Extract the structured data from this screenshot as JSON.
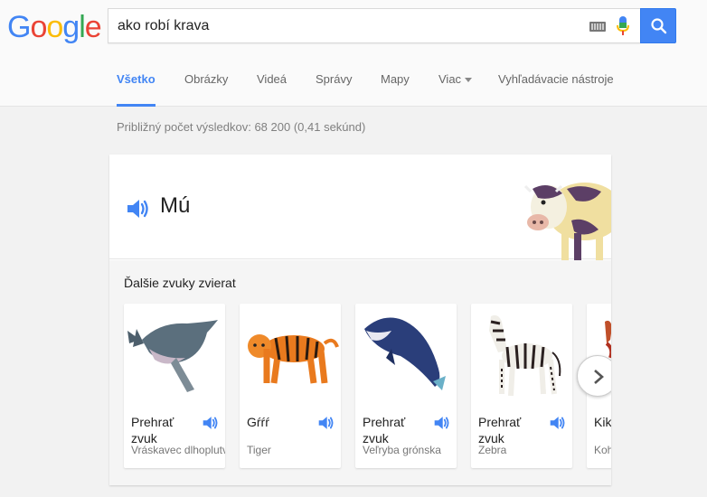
{
  "search": {
    "query": "ako robí krava"
  },
  "logo": [
    "G",
    "o",
    "o",
    "g",
    "l",
    "e"
  ],
  "nav": {
    "all": "Všetko",
    "images": "Obrázky",
    "videos": "Videá",
    "news": "Správy",
    "maps": "Mapy",
    "more": "Viac",
    "tools": "Vyhľadávacie nástroje"
  },
  "result_stats": "Približný počet výsledkov: 68 200 (0,41 sekúnd)",
  "card": {
    "answer": "Mú",
    "more_sounds_title": "Ďalšie zvuky zvierat",
    "animals": [
      {
        "label": "Prehrať zvuk",
        "sub": "Vráskavec dlhoplutvý"
      },
      {
        "label": "Gŕŕŕ",
        "sub": "Tiger"
      },
      {
        "label": "Prehrať zvuk",
        "sub": "Veľryba grónska"
      },
      {
        "label": "Prehrať zvuk",
        "sub": "Zebra"
      },
      {
        "label": "Kikiri",
        "sub": "Kohút"
      }
    ]
  },
  "colors": {
    "accent": "#4285f4",
    "google_blue": "#4285f4",
    "google_red": "#ea4335",
    "google_yellow": "#fbbc05",
    "google_green": "#34a853"
  }
}
